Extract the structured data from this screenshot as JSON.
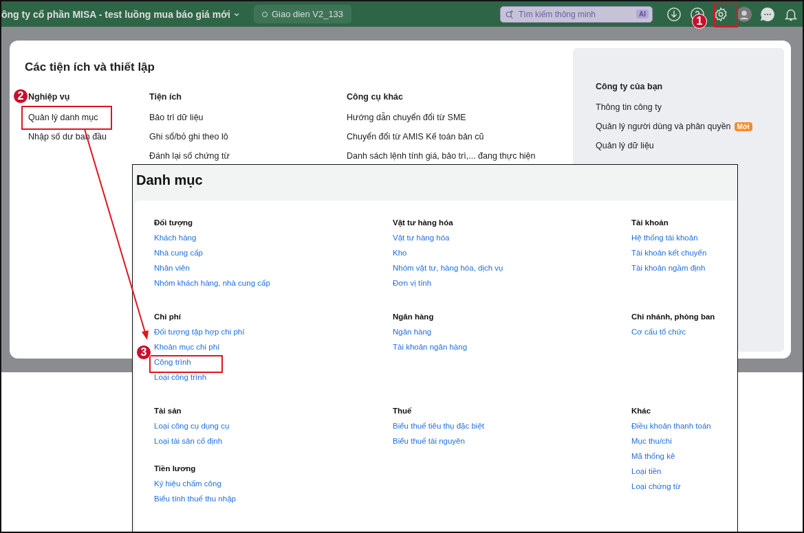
{
  "topbar": {
    "company": "ông ty cổ phần MISA - test luồng mua báo giá mới",
    "version": "Giao dien V2_133",
    "search": {
      "placeholder": "Tìm kiếm thông minh",
      "badge": "AI"
    }
  },
  "settings_dialog": {
    "title": "Các tiện ích và thiết lập",
    "columns": [
      {
        "heading": "Nghiệp vụ",
        "items": [
          "Quản lý danh mục",
          "Nhập số dư ban đầu"
        ]
      },
      {
        "heading": "Tiện ích",
        "items": [
          "Bảo trì dữ liệu",
          "Ghi sổ/bỏ ghi theo lô",
          "Đánh lại số chứng từ"
        ]
      },
      {
        "heading": "Công cụ khác",
        "items": [
          "Hướng dẫn chuyển đổi từ SME",
          "Chuyển đổi từ AMIS Kế toán bản cũ",
          "Danh sách lệnh tính giá, bảo trì,... đang thực hiện"
        ]
      }
    ],
    "company_panel": {
      "heading": "Công ty của bạn",
      "items": [
        {
          "label": "Thông tin công ty"
        },
        {
          "label": "Quản lý người dùng và phân quyền",
          "badge": "Mới"
        },
        {
          "label": "Quản lý dữ liệu"
        }
      ]
    }
  },
  "catalog": {
    "title": "Danh mục",
    "rows": [
      {
        "cells": [
          [
            {
              "heading": "Đối tượng",
              "items": [
                "Khách hàng",
                "Nhà cung cấp",
                "Nhân viên",
                "Nhóm khách hàng, nhà cung cấp"
              ]
            }
          ],
          [
            {
              "heading": "Vật tư hàng hóa",
              "items": [
                "Vật tư hàng hóa",
                "Kho",
                "Nhóm vật tư, hàng hóa, dịch vụ",
                "Đơn vị tính"
              ]
            }
          ],
          [
            {
              "heading": "Tài khoản",
              "items": [
                "Hệ thống tài khoản",
                "Tài khoản kết chuyển",
                "Tài khoản ngầm định"
              ]
            }
          ]
        ]
      },
      {
        "cells": [
          [
            {
              "heading": "Chi phí",
              "items": [
                "Đối tượng tập hợp chi phí",
                "Khoản mục chi phí",
                "Công trình",
                "Loại công trình"
              ]
            }
          ],
          [
            {
              "heading": "Ngân hàng",
              "items": [
                "Ngân hàng",
                "Tài khoản ngân hàng"
              ]
            }
          ],
          [
            {
              "heading": "Chi nhánh, phòng ban",
              "items": [
                "Cơ cấu tổ chức"
              ]
            }
          ]
        ]
      },
      {
        "cells": [
          [
            {
              "heading": "Tài sản",
              "items": [
                "Loại công cụ dụng cụ",
                "Loại tài sản cố định"
              ]
            },
            {
              "heading": "Tiền lương",
              "items": [
                "Ký hiệu chấm công",
                "Biểu tính thuế thu nhập"
              ]
            }
          ],
          [
            {
              "heading": "Thuế",
              "items": [
                "Biểu thuế tiêu thụ đặc biệt",
                "Biểu thuế tài nguyên"
              ]
            }
          ],
          [
            {
              "heading": "Khác",
              "items": [
                "Điều khoản thanh toán",
                "Mục thu/chi",
                "Mã thống kê",
                "Loại tiền",
                "Loại chứng từ"
              ]
            }
          ]
        ]
      }
    ]
  },
  "annotations": {
    "steps": [
      {
        "number": "1"
      },
      {
        "number": "2"
      },
      {
        "number": "3"
      }
    ]
  }
}
